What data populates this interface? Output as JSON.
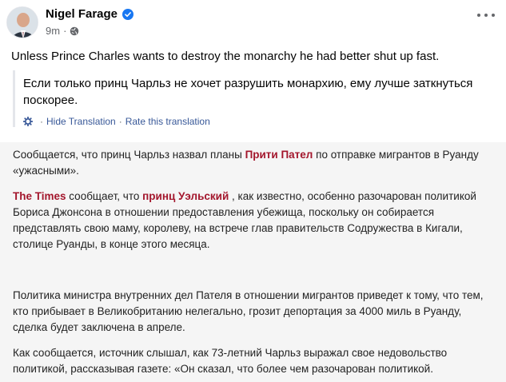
{
  "post": {
    "author": "Nigel Farage",
    "time": "9m",
    "dot": "·",
    "text": "Unless Prince Charles wants to destroy the monarchy he had better shut up fast.",
    "translation": "Если только принц Чарльз не хочет разрушить монархию, ему лучше заткнуться поскорее.",
    "hide_translation": "Hide Translation",
    "separator": "·",
    "rate_translation": "Rate this translation",
    "icons": [
      "verified-badge-icon",
      "globe-icon",
      "more-options-icon",
      "translation-gear-icon"
    ],
    "colors": {
      "verified": "#1877f2",
      "link": "#385898",
      "meta": "#65676b"
    }
  },
  "article": {
    "highlight_color": "#a3162c",
    "p1": {
      "before": "Сообщается, что принц Чарльз назвал планы ",
      "highlight": "Прити Пател",
      "after": " по отправке мигрантов в Руанду «ужасными»."
    },
    "p2": {
      "highlight1": "The Times",
      "middle": " сообщает, что ",
      "highlight2": "принц Уэльский",
      "after": " , как известно, особенно разочарован политикой Бориса Джонсона в отношении предоставления убежища, поскольку он собирается представлять свою маму, королеву, на встрече глав правительств Содружества в Кигали, столице Руанды, в конце этого месяца."
    },
    "p3": "Политика министра внутренних дел Пателя в отношении мигрантов приведет к тому, что тем, кто прибывает в Великобританию нелегально, грозит депортация за 4000 миль в Руанду, сделка будет заключена в апреле.",
    "p4": "Как сообщается, источник слышал, как 73-летний Чарльз выражал свое недовольство политикой, рассказывая газете: «Он сказал, что более чем разочарован политикой."
  }
}
